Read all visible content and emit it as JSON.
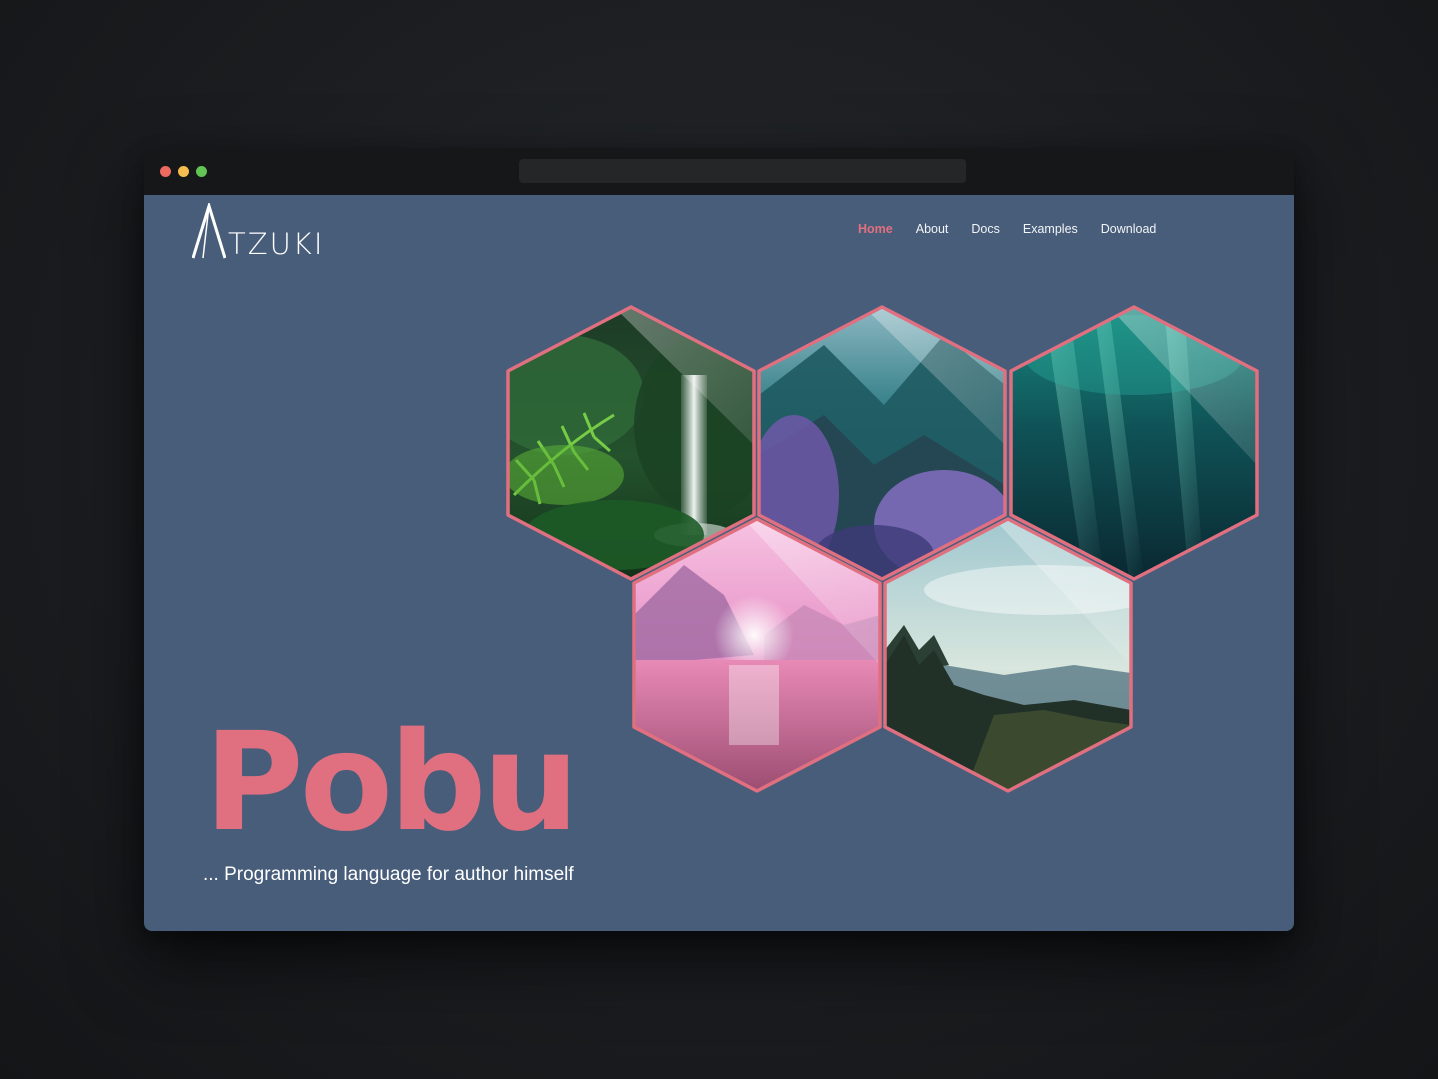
{
  "colors": {
    "page_background": "#485d7a",
    "accent": "#e07080",
    "window_dots": [
      "#ee6a5f",
      "#f5bd4f",
      "#61c454"
    ]
  },
  "logo": {
    "mark": "A",
    "text": "TZUKI"
  },
  "nav": {
    "items": [
      {
        "label": "Home",
        "active": true
      },
      {
        "label": "About",
        "active": false
      },
      {
        "label": "Docs",
        "active": false
      },
      {
        "label": "Examples",
        "active": false
      },
      {
        "label": "Download",
        "active": false
      }
    ]
  },
  "hero": {
    "title": "Pobu",
    "subtitle": "... Programming language for author himself"
  },
  "gallery": [
    {
      "name": "hex-image-waterfall",
      "scene": "jungle waterfall with fern"
    },
    {
      "name": "hex-image-mountain-valley",
      "scene": "teal mountain valley with purple foliage"
    },
    {
      "name": "hex-image-underwater",
      "scene": "deep teal underwater light rays"
    },
    {
      "name": "hex-image-pink-fjord",
      "scene": "pink sunset over fjord water"
    },
    {
      "name": "hex-image-forest-hills",
      "scene": "pine forest overlooking hills"
    }
  ]
}
